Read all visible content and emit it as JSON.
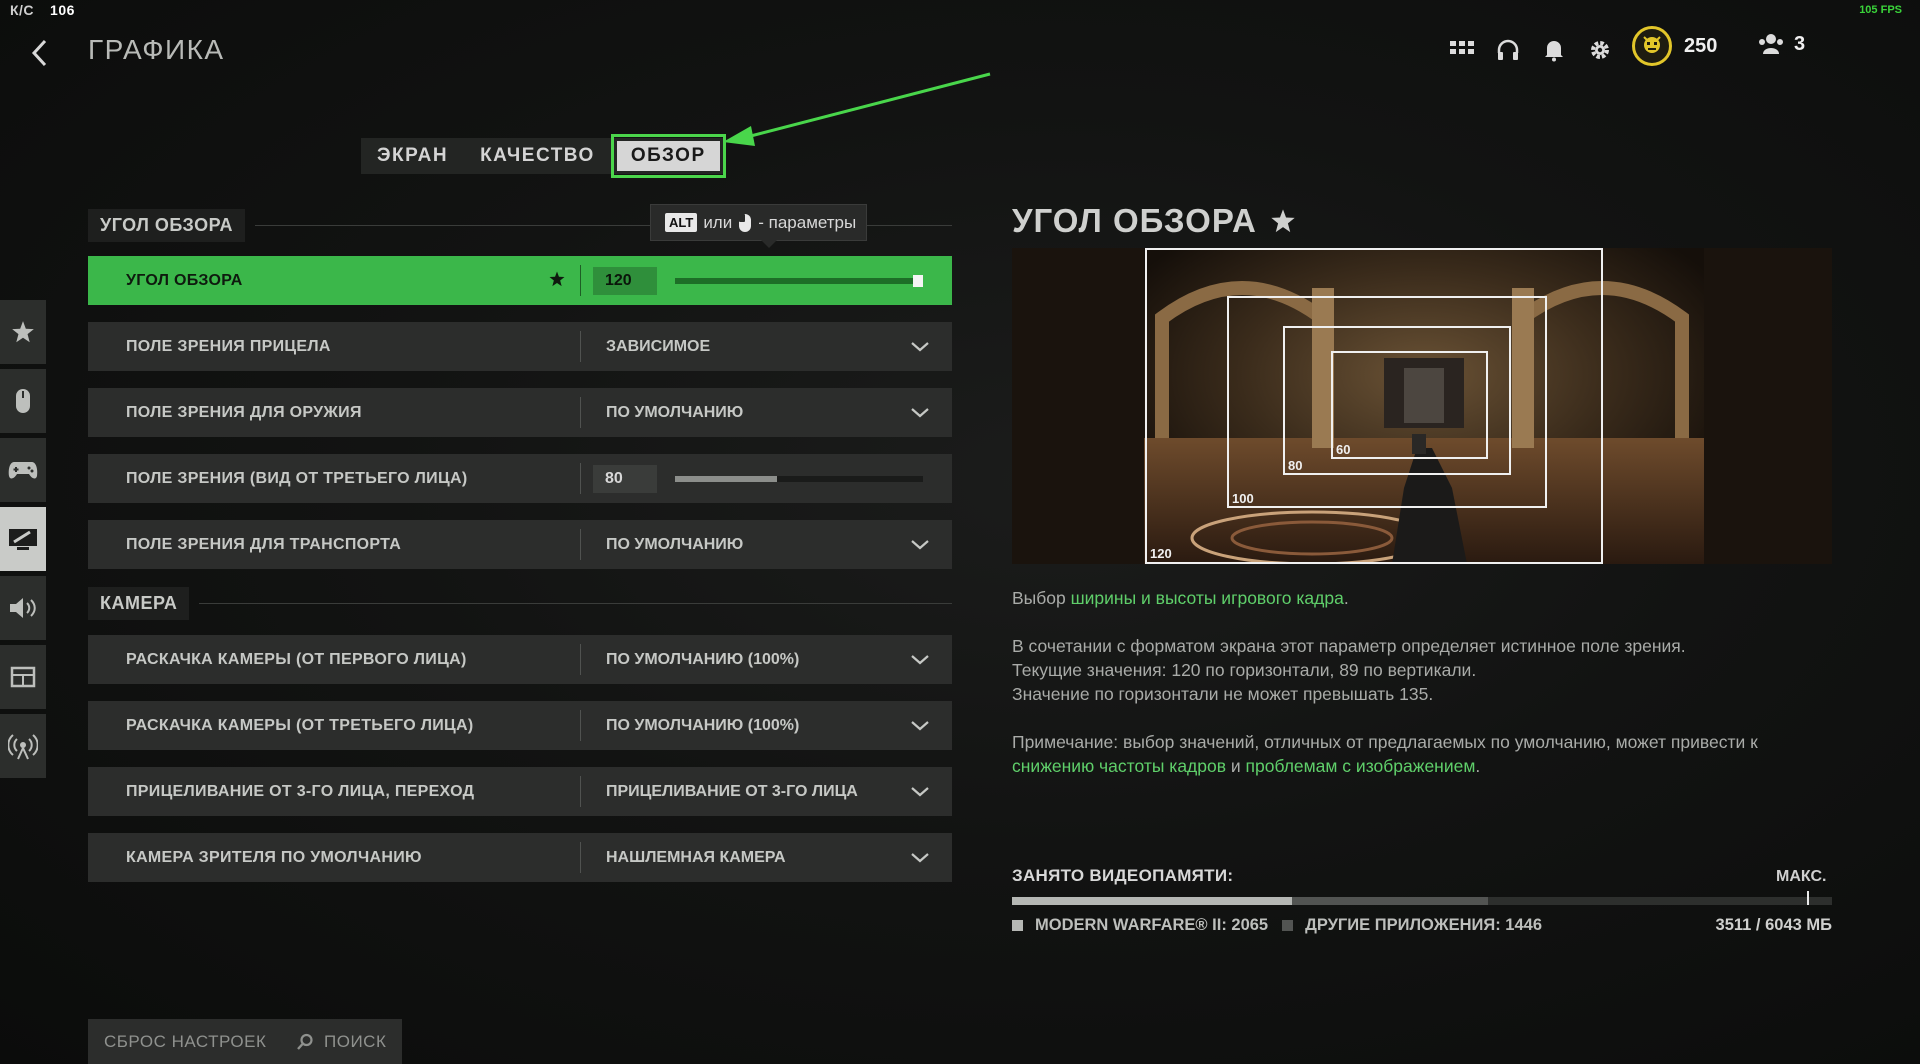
{
  "top": {
    "kd_label": "К/С",
    "kd_value": "106",
    "fps": "105 FPS",
    "title": "ГРАФИКА",
    "coins": "250",
    "party": "3"
  },
  "icons": {
    "back": "chevron-left-icon",
    "grid": "apps-grid-icon",
    "headset": "headset-icon",
    "bell": "bell-icon",
    "gear": "gear-icon",
    "coin": "cod-points-icon",
    "party": "party-icon"
  },
  "tabs": [
    {
      "label": "ЭКРАН"
    },
    {
      "label": "КАЧЕСТВО"
    },
    {
      "label": "ОБЗОР",
      "active": true
    }
  ],
  "tooltip": {
    "key": "ALT",
    "or": "или",
    "suffix": "- параметры"
  },
  "sections": {
    "fov": "УГОЛ ОБЗОРА",
    "camera": "КАМЕРА"
  },
  "rows": [
    {
      "name": "УГОЛ ОБЗОРА",
      "type": "slider",
      "value": "120",
      "fraction": 1.0
    },
    {
      "name": "ПОЛЕ ЗРЕНИЯ ПРИЦЕЛА",
      "type": "dropdown",
      "value": "ЗАВИСИМОЕ"
    },
    {
      "name": "ПОЛЕ ЗРЕНИЯ ДЛЯ ОРУЖИЯ",
      "type": "dropdown",
      "value": "ПО УМОЛЧАНИЮ"
    },
    {
      "name": "ПОЛЕ ЗРЕНИЯ (ВИД ОТ ТРЕТЬЕГО ЛИЦА)",
      "type": "slider",
      "value": "80",
      "fraction": 0.41
    },
    {
      "name": "ПОЛЕ ЗРЕНИЯ ДЛЯ ТРАНСПОРТА",
      "type": "dropdown",
      "value": "ПО УМОЛЧАНИЮ"
    },
    {
      "name": "РАСКАЧКА КАМЕРЫ (ОТ ПЕРВОГО ЛИЦА)",
      "type": "dropdown",
      "value": "ПО УМОЛЧАНИЮ (100%)"
    },
    {
      "name": "РАСКАЧКА КАМЕРЫ (ОТ ТРЕТЬЕГО ЛИЦА)",
      "type": "dropdown",
      "value": "ПО УМОЛЧАНИЮ (100%)"
    },
    {
      "name": "ПРИЦЕЛИВАНИЕ ОТ 3-ГО ЛИЦА, ПЕРЕХОД",
      "type": "dropdown",
      "value": "ПРИЦЕЛИВАНИЕ ОТ 3-ГО ЛИЦА"
    },
    {
      "name": "КАМЕРА ЗРИТЕЛЯ ПО УМОЛЧАНИЮ",
      "type": "dropdown",
      "value": "НАШЛЕМНАЯ КАМЕРА"
    }
  ],
  "detail": {
    "title": "УГОЛ ОБЗОРА",
    "preview_labels": [
      "120",
      "100",
      "80",
      "60"
    ],
    "p1_a": "Выбор ",
    "p1_g": "ширины и высоты игрового кадра",
    "p1_b": ".",
    "p2_l1": "В сочетании с форматом экрана этот параметр определяет истинное поле зрения.",
    "p2_l2": "Текущие значения: 120 по горизонтали, 89 по вертикали.",
    "p2_l3": "Значение по горизонтали не может превышать 135.",
    "p3_a": "Примечание: выбор значений, отличных от предлагаемых по умолчанию, может привести к ",
    "p3_g1": "снижению частоты кадров",
    "p3_b": " и ",
    "p3_g2": "проблемам с изображением",
    "p3_c": "."
  },
  "vram": {
    "title": "ЗАНЯТО ВИДЕОПАМЯТИ:",
    "max_label": "МАКС.",
    "mw_label": "MODERN WARFARE® II: 2065",
    "other_label": "ДРУГИЕ ПРИЛОЖЕНИЯ: 1446",
    "total": "3511 / 6043 МБ",
    "mw_value": 2065,
    "other_value": 1446,
    "max_value": 6043,
    "cap_fraction": 0.97
  },
  "bottom": {
    "reset": "СБРОС НАСТРОЕК",
    "search": "ПОИСК"
  },
  "colors": {
    "accent": "#3bb74a",
    "highlight_green": "#5fcf6a",
    "coin_gold": "#e2c62a"
  }
}
